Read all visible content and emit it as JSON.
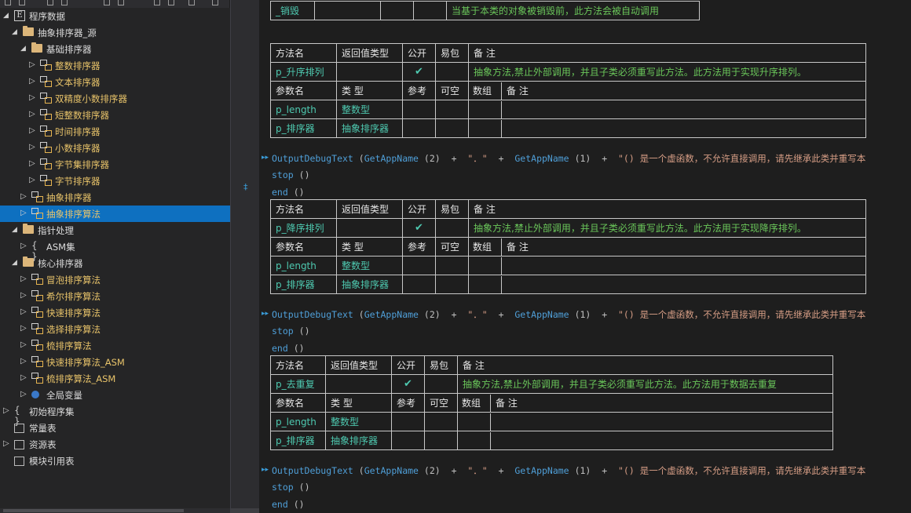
{
  "sidebar": {
    "items": [
      {
        "label": "程序数据",
        "icon": "module-e-icon",
        "expanded": true
      },
      {
        "label": "抽象排序器_源",
        "icon": "folder-icon",
        "expanded": true
      },
      {
        "label": "基础排序器",
        "icon": "folder-icon",
        "expanded": true
      },
      {
        "label": "整数排序器",
        "icon": "class-icon"
      },
      {
        "label": "文本排序器",
        "icon": "class-icon"
      },
      {
        "label": "双精度小数排序器",
        "icon": "class-icon"
      },
      {
        "label": "短整数排序器",
        "icon": "class-icon"
      },
      {
        "label": "时间排序器",
        "icon": "class-icon"
      },
      {
        "label": "小数排序器",
        "icon": "class-icon"
      },
      {
        "label": "字节集排序器",
        "icon": "class-icon"
      },
      {
        "label": "字节排序器",
        "icon": "class-icon"
      },
      {
        "label": "抽象排序器",
        "icon": "class-icon"
      },
      {
        "label": "抽象排序算法",
        "icon": "class-icon",
        "selected": true
      },
      {
        "label": "指针处理",
        "icon": "folder-icon",
        "expanded": true
      },
      {
        "label": "ASM集",
        "icon": "braces-icon"
      },
      {
        "label": "核心排序器",
        "icon": "folder-icon",
        "expanded": true
      },
      {
        "label": "冒泡排序算法",
        "icon": "class-icon"
      },
      {
        "label": "希尔排序算法",
        "icon": "class-icon"
      },
      {
        "label": "快速排序算法",
        "icon": "class-icon"
      },
      {
        "label": "选择排序算法",
        "icon": "class-icon"
      },
      {
        "label": "梳排序算法",
        "icon": "class-icon"
      },
      {
        "label": "快速排序算法_ASM",
        "icon": "class-icon"
      },
      {
        "label": "梳排序算法_ASM",
        "icon": "class-icon"
      },
      {
        "label": "全局变量",
        "icon": "global-var-icon"
      },
      {
        "label": "初始程序集",
        "icon": "braces-icon"
      },
      {
        "label": "常量表",
        "icon": "constant-table-icon"
      },
      {
        "label": "资源表",
        "icon": "resource-table-icon"
      },
      {
        "label": "模块引用表",
        "icon": "module-ref-icon"
      }
    ]
  },
  "code": {
    "top_row": {
      "name": "_销毁",
      "comment": "当基于本类的对象被销毁前，此方法会被自动调用"
    },
    "headers": {
      "method": "方法名",
      "return_type": "返回值类型",
      "public": "公开",
      "easy_pack": "易包",
      "note": "备 注",
      "param": "参数名",
      "type": "类 型",
      "ref": "参考",
      "nullable": "可空",
      "array": "数组"
    },
    "check": "✔",
    "methods": [
      {
        "name": "p_升序排列",
        "comment": "抽象方法,禁止外部调用，并且子类必须重写此方法。此方法用于实现升序排列。",
        "params": [
          {
            "name": "p_length",
            "type": "整数型"
          },
          {
            "name": "p_排序器",
            "type": "抽象排序器"
          }
        ]
      },
      {
        "name": "p_降序排列",
        "comment": "抽象方法,禁止外部调用，并且子类必须重写此方法。此方法用于实现降序排列。",
        "params": [
          {
            "name": "p_length",
            "type": "整数型"
          },
          {
            "name": "p_排序器",
            "type": "抽象排序器"
          }
        ]
      },
      {
        "name": "p_去重复",
        "comment": "抽象方法,禁止外部调用，并且子类必须重写此方法。此方法用于数据去重复",
        "params": [
          {
            "name": "p_length",
            "type": "整数型"
          },
          {
            "name": "p_排序器",
            "type": "抽象排序器"
          }
        ]
      }
    ],
    "lines": {
      "fn1": "OutputDebugText",
      "fn2": "GetAppName",
      "arg1": "(2)",
      "arg2": "(1)",
      "plus": "+",
      "dot": "\"．\"",
      "msg": "\"() 是一个虚函数，不允许直接调用，请先继承此类并重写本",
      "stop": "stop",
      "end": "end",
      "paren": "()",
      "open": "("
    }
  },
  "colors": {
    "accent": "#0e70c0",
    "comment": "#6ac65a",
    "type": "#4ec9b0",
    "keyword": "#4f9fd8",
    "string": "#d69d85",
    "folder": "#dcb67a"
  }
}
